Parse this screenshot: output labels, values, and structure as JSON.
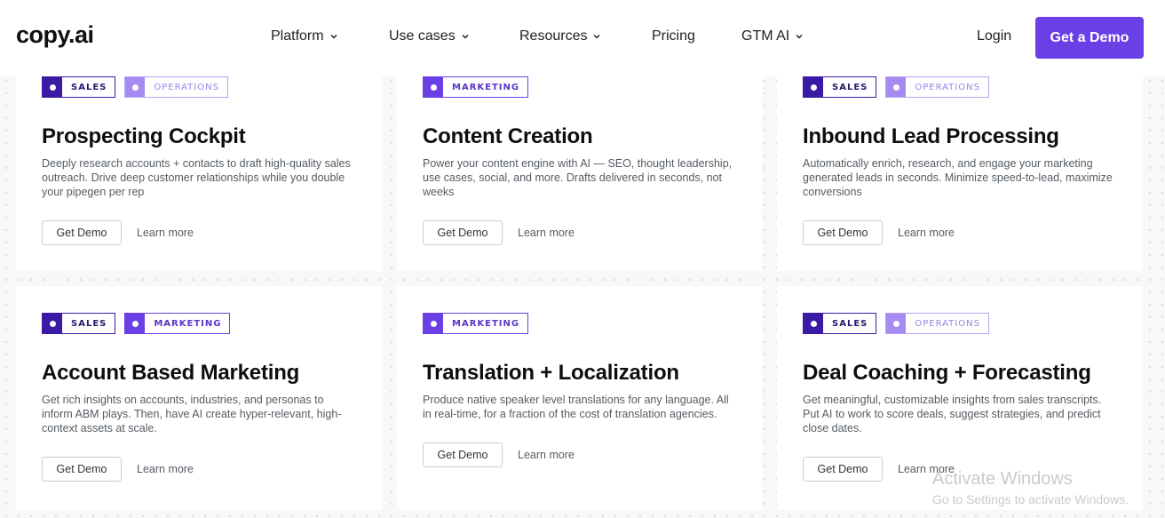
{
  "header": {
    "logo": "copy.ai",
    "nav": [
      {
        "label": "Platform",
        "has_dropdown": true
      },
      {
        "label": "Use cases",
        "has_dropdown": true
      },
      {
        "label": "Resources",
        "has_dropdown": true
      },
      {
        "label": "Pricing",
        "has_dropdown": false
      },
      {
        "label": "GTM AI",
        "has_dropdown": true
      }
    ],
    "login": "Login",
    "cta": "Get a Demo"
  },
  "cards": [
    {
      "tags": [
        "SALES",
        "OPERATIONS"
      ],
      "title": "Prospecting Cockpit",
      "description": "Deeply research accounts + contacts to draft high-quality sales outreach. Drive deep customer relationships while you double your pipegen per rep",
      "demo_label": "Get Demo",
      "learn_label": "Learn more"
    },
    {
      "tags": [
        "MARKETING"
      ],
      "title": "Content Creation",
      "description": "Power your content engine with AI — SEO, thought leadership, use cases, social, and more. Drafts delivered in seconds, not weeks",
      "demo_label": "Get Demo",
      "learn_label": "Learn more"
    },
    {
      "tags": [
        "SALES",
        "OPERATIONS"
      ],
      "title": "Inbound Lead Processing",
      "description": "Automatically enrich, research, and engage your marketing generated leads in seconds. Minimize speed-to-lead, maximize conversions",
      "demo_label": "Get Demo",
      "learn_label": "Learn more"
    },
    {
      "tags": [
        "SALES",
        "MARKETING"
      ],
      "title": "Account Based Marketing",
      "description": "Get rich insights on accounts, industries, and personas to inform ABM plays. Then, have AI create hyper-relevant, high-context assets at scale.",
      "demo_label": "Get Demo",
      "learn_label": "Learn more"
    },
    {
      "tags": [
        "MARKETING"
      ],
      "title": "Translation + Localization",
      "description": "Produce native speaker level translations for any language. All in real-time, for a fraction of the cost of translation agencies.",
      "demo_label": "Get Demo",
      "learn_label": "Learn more"
    },
    {
      "tags": [
        "SALES",
        "OPERATIONS"
      ],
      "title": "Deal Coaching + Forecasting",
      "description": "Get meaningful, customizable insights from sales transcripts. Put AI to work to score deals, suggest strategies, and predict close dates.",
      "demo_label": "Get Demo",
      "learn_label": "Learn more"
    }
  ],
  "watermark": {
    "line1": "Activate Windows",
    "line2": "Go to Settings to activate Windows."
  },
  "colors": {
    "accent": "#6b3fe6",
    "sales_tag": "#3b1aa6",
    "operations_tag": "#a58bf0"
  }
}
